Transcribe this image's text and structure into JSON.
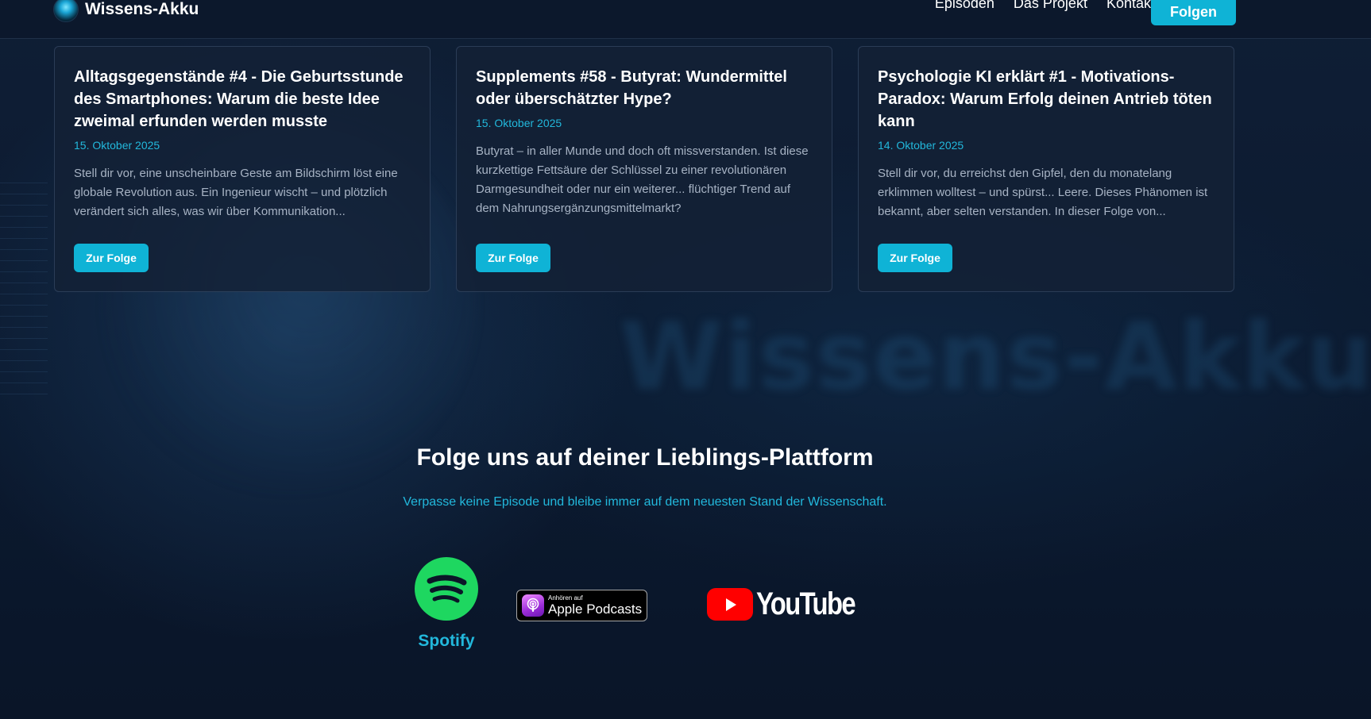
{
  "header": {
    "brand_name": "Wissens-Akku",
    "nav": [
      "Episoden",
      "Das Projekt",
      "Kontakt"
    ],
    "cta_label": "Folgen"
  },
  "background": {
    "watermark_text": "Wissens-Akku"
  },
  "episodes": [
    {
      "title": "Alltagsgegenstände #4 - Die Geburtsstunde des Smartphones: Warum die beste Idee zweimal erfunden werden musste",
      "date": "15. Oktober 2025",
      "excerpt": "Stell dir vor, eine unscheinbare Geste am Bildschirm löst eine globale Revolution aus. Ein Ingenieur wischt – und plötzlich verändert sich alles, was wir über Kommunikation...",
      "button_label": "Zur Folge"
    },
    {
      "title": "Supplements #58 - Butyrat: Wundermittel oder überschätzter Hype?",
      "date": "15. Oktober 2025",
      "excerpt": "Butyrat – in aller Munde und doch oft missverstanden. Ist diese kurzkettige Fettsäure der Schlüssel zu einer revolutionären Darmgesundheit oder nur ein weiterer... flüchtiger Trend auf dem Nahrungsergänzungsmittelmarkt?",
      "button_label": "Zur Folge"
    },
    {
      "title": "Psychologie KI erklärt #1 - Motivations-Paradox: Warum Erfolg deinen Antrieb töten kann",
      "date": "14. Oktober 2025",
      "excerpt": "Stell dir vor, du erreichst den Gipfel, den du monatelang erklimmen wolltest – und spürst... Leere. Dieses Phänomen ist bekannt, aber selten verstanden. In dieser Folge von...",
      "button_label": "Zur Folge"
    }
  ],
  "follow": {
    "title": "Folge uns auf deiner Lieblings-Plattform",
    "subtitle": "Verpasse keine Episode und bleibe immer auf dem neuesten Stand der Wissenschaft."
  },
  "platforms": {
    "spotify_label": "Spotify",
    "apple_small": "Anhören auf",
    "apple_big": "Apple Podcasts",
    "youtube_word": "YouTube"
  },
  "colors": {
    "accent": "#0fb3d6",
    "accent_text": "#22b8dc",
    "background": "#0b1628",
    "spotify_green": "#1ed760",
    "youtube_red": "#ff0000"
  }
}
